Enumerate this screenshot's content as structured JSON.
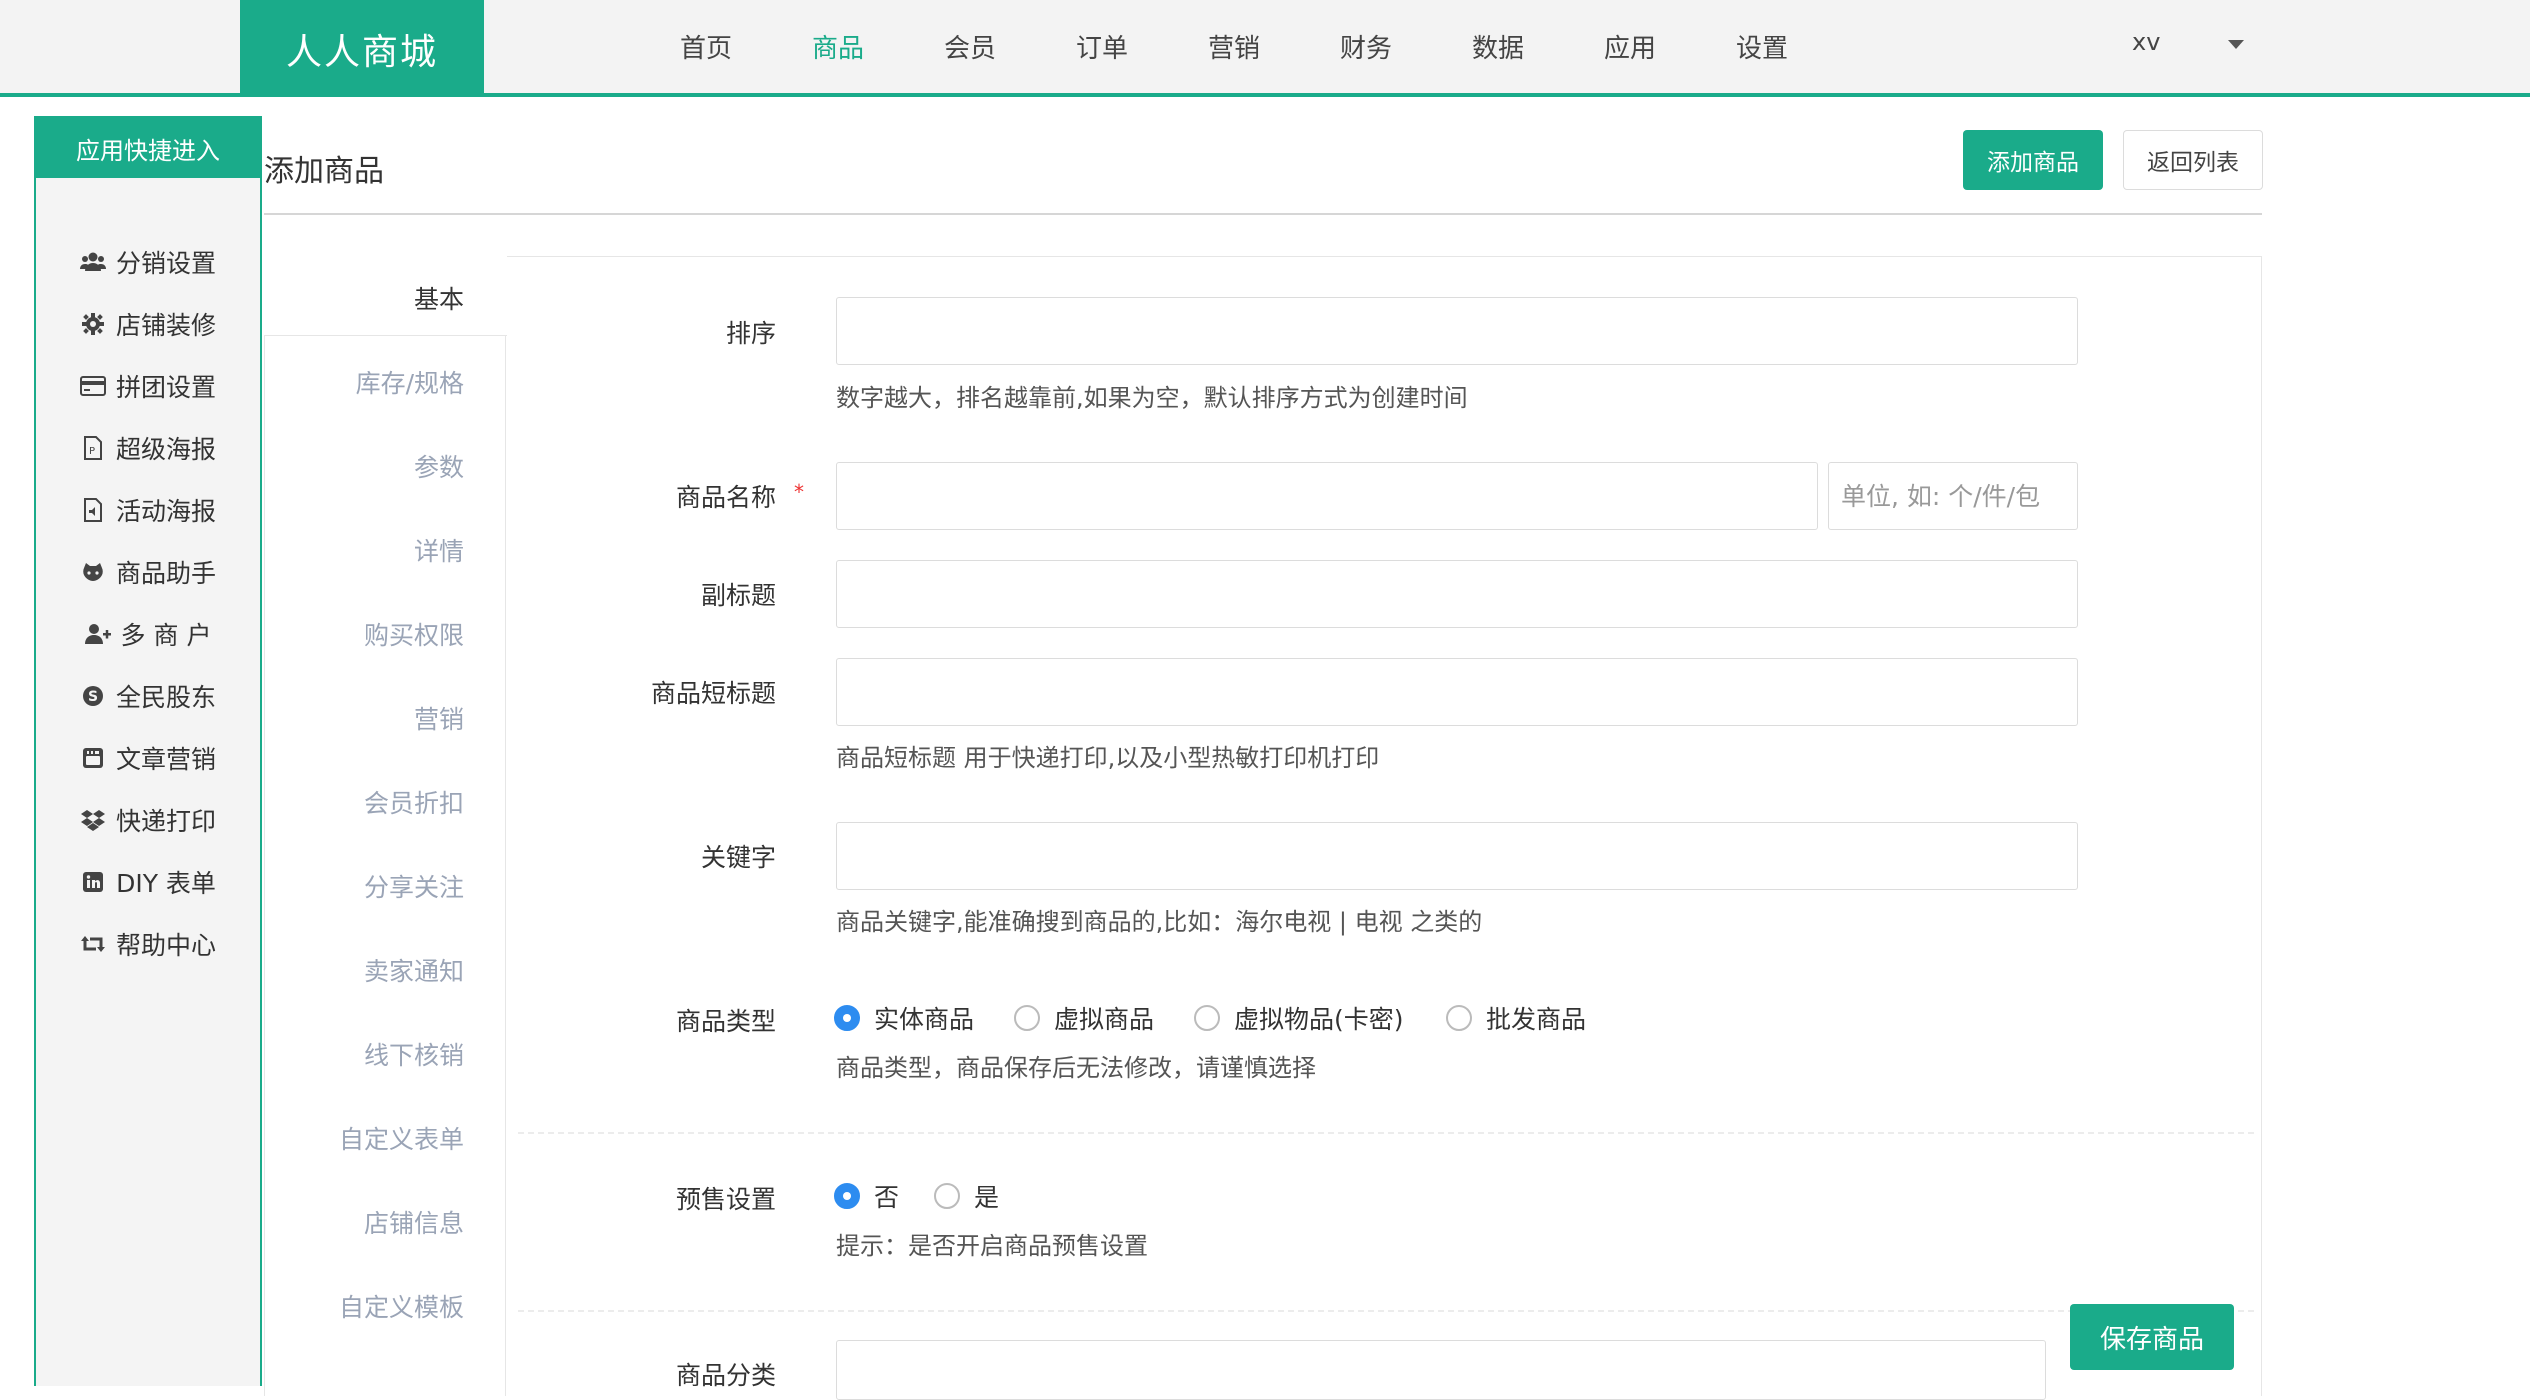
{
  "brand": {
    "name": "人人商城",
    "accent": "#1aab8a"
  },
  "nav": {
    "items": [
      "首页",
      "商品",
      "会员",
      "订单",
      "营销",
      "财务",
      "数据",
      "应用",
      "设置"
    ],
    "active": "商品",
    "user": "xv"
  },
  "quick_panel": {
    "title": "应用快捷进入",
    "items": [
      {
        "label": "分销设置",
        "icon": "users-icon"
      },
      {
        "label": "店铺装修",
        "icon": "gear-icon"
      },
      {
        "label": "拼团设置",
        "icon": "credit-card-icon"
      },
      {
        "label": "超级海报",
        "icon": "poster-file-icon"
      },
      {
        "label": "活动海报",
        "icon": "audio-file-icon"
      },
      {
        "label": "商品助手",
        "icon": "github-icon"
      },
      {
        "label": "多 商 户",
        "icon": "user-plus-icon"
      },
      {
        "label": "全民股东",
        "icon": "skype-icon"
      },
      {
        "label": "文章营销",
        "icon": "youtube-icon"
      },
      {
        "label": "快递打印",
        "icon": "dropbox-icon"
      },
      {
        "label": "DIY 表单",
        "icon": "linkedin-icon"
      },
      {
        "label": "帮助中心",
        "icon": "retweet-icon"
      }
    ]
  },
  "page": {
    "title": "添加商品",
    "add_button": "添加商品",
    "back_button": "返回列表",
    "save_button": "保存商品"
  },
  "tabs": [
    "基本",
    "库存/规格",
    "参数",
    "详情",
    "购买权限",
    "营销",
    "会员折扣",
    "分享关注",
    "卖家通知",
    "线下核销",
    "自定义表单",
    "店铺信息",
    "自定义模板"
  ],
  "form": {
    "sort": {
      "label": "排序",
      "value": "",
      "help": "数字越大，排名越靠前,如果为空，默认排序方式为创建时间"
    },
    "name": {
      "label": "商品名称",
      "required_mark": "*",
      "value": "",
      "unit_placeholder": "单位, 如: 个/件/包"
    },
    "subtitle": {
      "label": "副标题",
      "value": ""
    },
    "short_title": {
      "label": "商品短标题",
      "value": "",
      "help": "商品短标题 用于快递打印,以及小型热敏打印机打印"
    },
    "keywords": {
      "label": "关键字",
      "value": "",
      "help": "商品关键字,能准确搜到商品的,比如：海尔电视 | 电视 之类的"
    },
    "type": {
      "label": "商品类型",
      "options": [
        "实体商品",
        "虚拟商品",
        "虚拟物品(卡密)",
        "批发商品"
      ],
      "selected": "实体商品",
      "help": "商品类型，商品保存后无法修改，请谨慎选择"
    },
    "presale": {
      "label": "预售设置",
      "options": [
        "否",
        "是"
      ],
      "selected": "否",
      "help": "提示：是否开启商品预售设置"
    },
    "category": {
      "label": "商品分类"
    }
  }
}
